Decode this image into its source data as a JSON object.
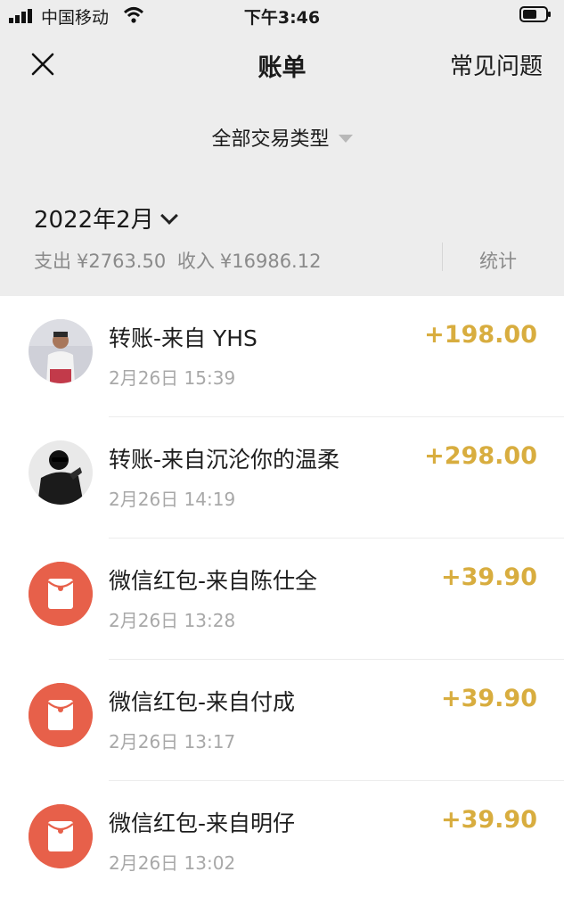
{
  "status_bar": {
    "carrier": "中国移动",
    "time": "下午3:46"
  },
  "nav": {
    "title": "账单",
    "faq_label": "常见问题"
  },
  "filter": {
    "label": "全部交易类型"
  },
  "month": {
    "label": "2022年2月"
  },
  "summary": {
    "expense_label": "支出",
    "expense_value": "¥2763.50",
    "income_label": "收入",
    "income_value": "¥16986.12",
    "stats_label": "统计"
  },
  "transactions": [
    {
      "title": "转账-来自 YHS",
      "time": "2月26日 15:39",
      "amount": "+198.00",
      "icon": "user-avatar-photo"
    },
    {
      "title": "转账-来自沉沦你的温柔",
      "time": "2月26日 14:19",
      "amount": "+298.00",
      "icon": "user-avatar-photo"
    },
    {
      "title": "微信红包-来自陈仕全",
      "time": "2月26日 13:28",
      "amount": "+39.90",
      "icon": "red-packet-icon"
    },
    {
      "title": "微信红包-来自付成",
      "time": "2月26日 13:17",
      "amount": "+39.90",
      "icon": "red-packet-icon"
    },
    {
      "title": "微信红包-来自明仔",
      "time": "2月26日 13:02",
      "amount": "+39.90",
      "icon": "red-packet-icon"
    }
  ],
  "colors": {
    "amount": "#d8ad3f",
    "red_packet": "#e7604a",
    "header_bg": "#ededed"
  }
}
